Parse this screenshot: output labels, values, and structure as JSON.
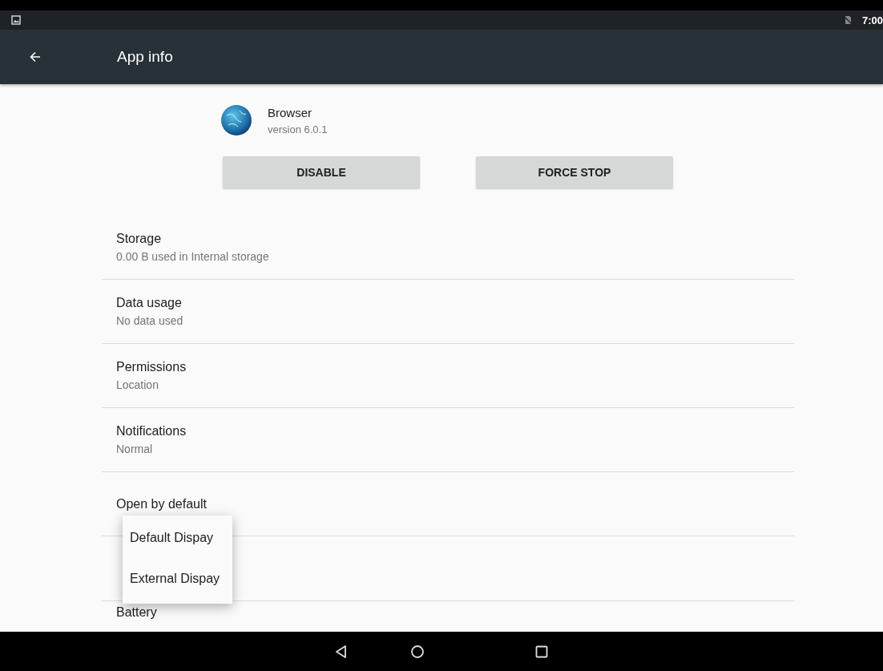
{
  "status_bar": {
    "time": "7:00"
  },
  "toolbar": {
    "title": "App info"
  },
  "app": {
    "name": "Browser",
    "version": "version 6.0.1"
  },
  "buttons": [
    "DISABLE",
    "FORCE STOP"
  ],
  "settings": [
    {
      "title": "Storage",
      "subtitle": "0.00 B used in Internal storage"
    },
    {
      "title": "Data usage",
      "subtitle": "No data used"
    },
    {
      "title": "Permissions",
      "subtitle": "Location"
    },
    {
      "title": "Notifications",
      "subtitle": "Normal"
    },
    {
      "title": "Open by default"
    },
    {
      "title": "Battery"
    }
  ],
  "popup_menu": {
    "items": [
      "Default Dispay",
      "External Dispay"
    ]
  }
}
